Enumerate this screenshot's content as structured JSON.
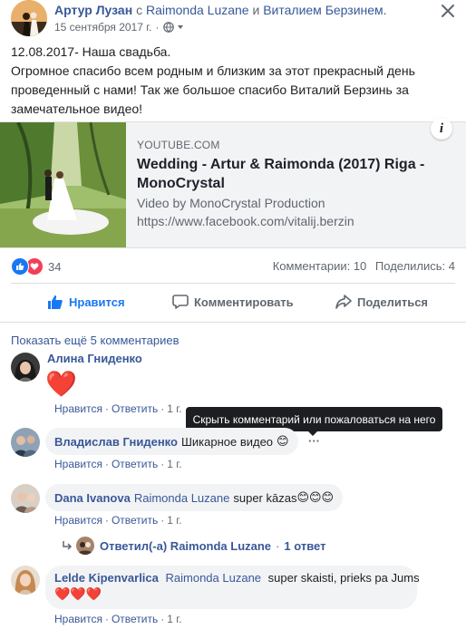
{
  "post": {
    "author": "Артур Лузан",
    "with_word": "с",
    "tagged_1": "Raimonda Luzane",
    "and_word": "и",
    "tagged_2": "Виталием Берзинем.",
    "date": "15 сентября 2017 г.",
    "dot": "·",
    "text_line1": "12.08.2017- Наша свадьба.",
    "text_line2": "Огромное спасибо всем родным и близким за этот прекрасный день",
    "text_line3": "проведенный с нами! Так же большое спасибо Виталий Берзинь за",
    "text_line4": "замечательное видео!"
  },
  "link_preview": {
    "source": "YOUTUBE.COM",
    "title_line1": "Wedding - Artur & Raimonda (2017) Riga -",
    "title_line2": "MonoCrystal",
    "subtitle": "Video by MonoCrystal Production",
    "url": "https://www.facebook.com/vitalij.berzin",
    "info_glyph": "i"
  },
  "stats": {
    "reactions_count": "34",
    "comments": "Комментарии: 10",
    "shares": "Поделились: 4"
  },
  "action_bar": {
    "like": "Нравится",
    "comment": "Комментировать",
    "share": "Поделиться"
  },
  "comments_section": {
    "show_more": "Показать ещё 5 комментариев",
    "action_like": "Нравится",
    "action_reply": "Ответить",
    "dot": "·",
    "tooltip": "Скрыть комментарий или пожаловаться на него",
    "more_glyph": "···",
    "items": [
      {
        "author": "Алина Гниденко",
        "mention": "",
        "text": "",
        "emoji": "❤️",
        "time": "1 г."
      },
      {
        "author": "Владислав Гниденко",
        "mention": "",
        "text": "Шикарное видео",
        "emoji": "😊",
        "time": "1 г."
      },
      {
        "author": "Dana Ivanova",
        "mention": "Raimonda Luzane",
        "text": "super kāzas",
        "emoji": "😊😊😊",
        "time": "1 г."
      },
      {
        "author": "Lelde Kipenvarlica",
        "mention": "Raimonda Luzane",
        "text": "super skaisti, prieks pa Jums",
        "emoji": "❤️❤️❤️",
        "time": "1 г."
      }
    ],
    "reply_summary": {
      "label": "Ответил(-а) Raimonda Luzane",
      "count": "1 ответ"
    }
  },
  "colors": {
    "link_blue": "#385898",
    "like_blue": "#1877f2",
    "bubble_bg": "#f2f3f5",
    "tooltip_bg": "#1c1e21"
  }
}
